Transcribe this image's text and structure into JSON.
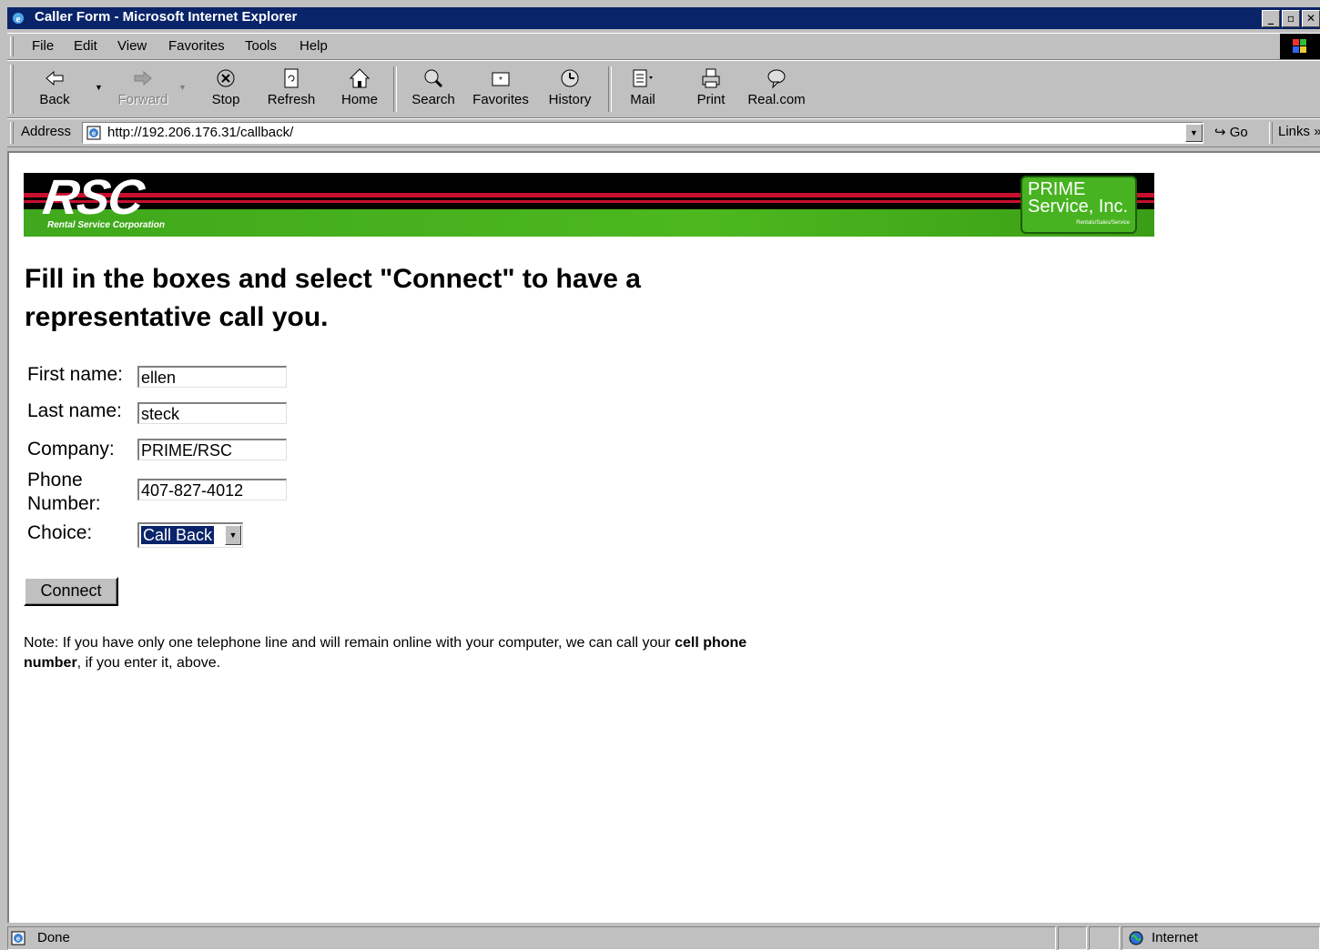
{
  "window": {
    "title": "Caller Form - Microsoft Internet Explorer"
  },
  "menu": {
    "items": [
      {
        "label": "File"
      },
      {
        "label": "Edit"
      },
      {
        "label": "View"
      },
      {
        "label": "Favorites"
      },
      {
        "label": "Tools"
      },
      {
        "label": "Help"
      }
    ]
  },
  "toolbar": {
    "back": "Back",
    "forward": "Forward",
    "stop": "Stop",
    "refresh": "Refresh",
    "home": "Home",
    "search": "Search",
    "favorites": "Favorites",
    "history": "History",
    "mail": "Mail",
    "print": "Print",
    "real": "Real.com"
  },
  "address": {
    "label": "Address",
    "url": "http://192.206.176.31/callback/",
    "go": "Go",
    "links": "Links"
  },
  "page": {
    "banner": {
      "logo": "RSC",
      "logo_sub": "Rental Service Corporation",
      "prime_line1": "PRIME",
      "prime_line2": "Service, Inc.",
      "prime_line3": "Rentals/Sales/Service"
    },
    "heading": "Fill in the boxes and select \"Connect\" to have a representative call you.",
    "form": {
      "first_name_label": "First name:",
      "first_name_value": "ellen",
      "last_name_label": "Last name:",
      "last_name_value": "steck",
      "company_label": "Company:",
      "company_value": "PRIME/RSC",
      "phone_label_1": "Phone",
      "phone_label_2": "Number:",
      "phone_value": "407-827-4012",
      "choice_label": "Choice:",
      "choice_value": "Call Back"
    },
    "connect_label": "Connect",
    "note_prefix": "Note: If you have only one telephone line and will remain online with your computer, we can call your ",
    "note_bold": "cell phone number",
    "note_suffix": ", if you enter it, above."
  },
  "status": {
    "text": "Done",
    "zone": "Internet"
  }
}
